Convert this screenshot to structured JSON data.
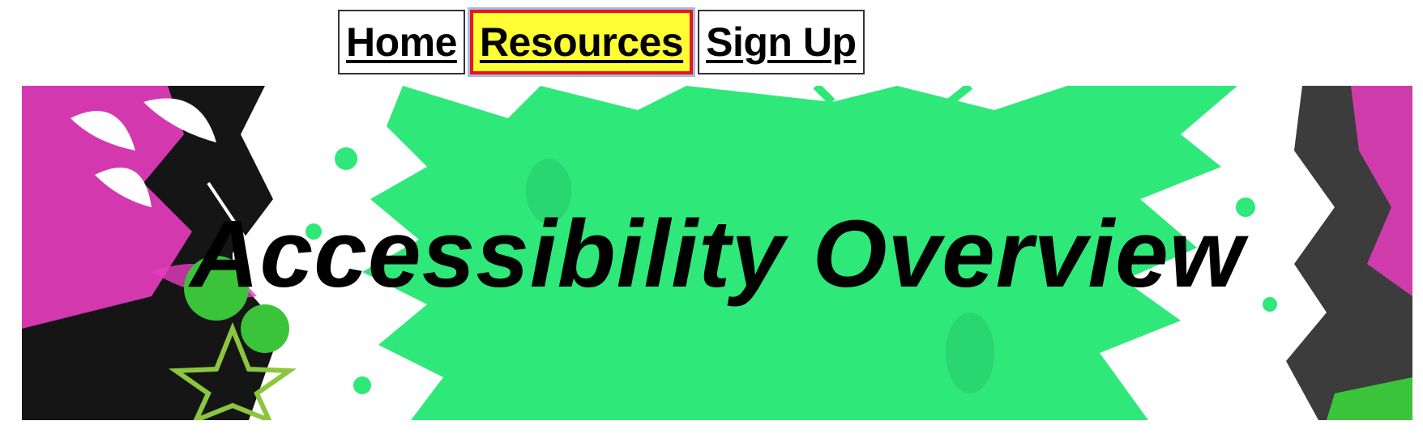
{
  "nav": {
    "items": [
      {
        "label": "Home",
        "active": false
      },
      {
        "label": "Resources",
        "active": true
      },
      {
        "label": "Sign Up",
        "active": false
      }
    ],
    "active_bg": "#ffff33",
    "active_border": "#e4171b"
  },
  "banner": {
    "title": "Accessibility Overview",
    "splash_color": "#2ee87a",
    "accent_pink": "#e83cc0"
  }
}
